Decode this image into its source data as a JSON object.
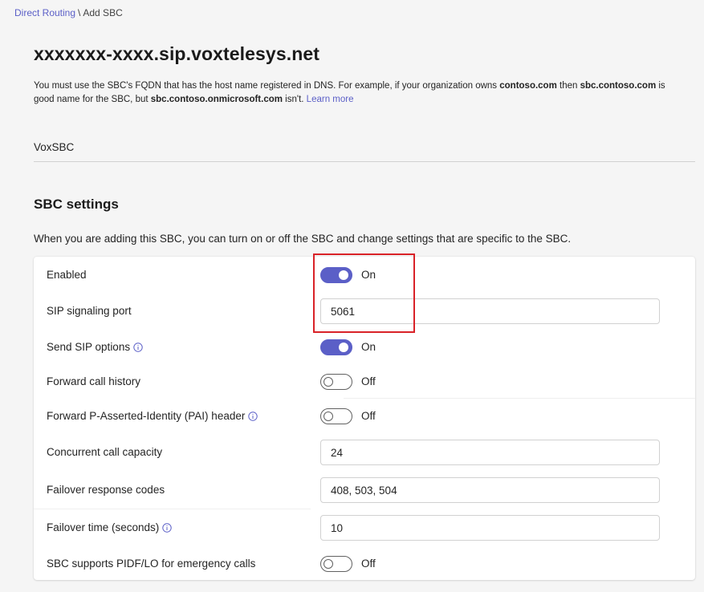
{
  "breadcrumb": {
    "parent": "Direct Routing",
    "separator": "\\",
    "current": "Add SBC"
  },
  "page": {
    "title": "xxxxxxx-xxxx.sip.voxtelesys.net",
    "help": {
      "t1": "You must use the SBC's FQDN that has the host name registered in DNS. For example, if your organization owns ",
      "b1": "contoso.com",
      "t2": " then ",
      "b2": "sbc.contoso.com",
      "t3": " is good name for the SBC, but ",
      "b3": "sbc.contoso.onmicrosoft.com",
      "t4": " isn't. ",
      "link": "Learn more"
    },
    "description_value": "VoxSBC"
  },
  "sbc_settings": {
    "title": "SBC settings",
    "description": "When you are adding this SBC, you can turn on or off the SBC and change settings that are specific to the SBC.",
    "rows": [
      {
        "label": "Enabled",
        "type": "toggle",
        "on": true,
        "state": "On"
      },
      {
        "label": "SIP signaling port",
        "type": "input",
        "value": "5061"
      },
      {
        "label": "Send SIP options",
        "type": "toggle",
        "on": true,
        "state": "On",
        "info": true
      },
      {
        "label": "Forward call history",
        "type": "toggle",
        "on": false,
        "state": "Off"
      },
      {
        "label": "Forward P-Asserted-Identity (PAI) header",
        "type": "toggle",
        "on": false,
        "state": "Off",
        "info": true
      },
      {
        "label": "Concurrent call capacity",
        "type": "input",
        "value": "24"
      },
      {
        "label": "Failover response codes",
        "type": "input",
        "value": "408, 503, 504"
      },
      {
        "label": "Failover time (seconds)",
        "type": "input",
        "value": "10",
        "info": true
      },
      {
        "label": "SBC supports PIDF/LO for emergency calls",
        "type": "toggle",
        "on": false,
        "state": "Off"
      }
    ]
  },
  "colors": {
    "accent": "#5b5fc7",
    "highlight": "#d92228",
    "background": "#f5f5f5"
  },
  "icons": {
    "info": "info-circle-icon"
  }
}
